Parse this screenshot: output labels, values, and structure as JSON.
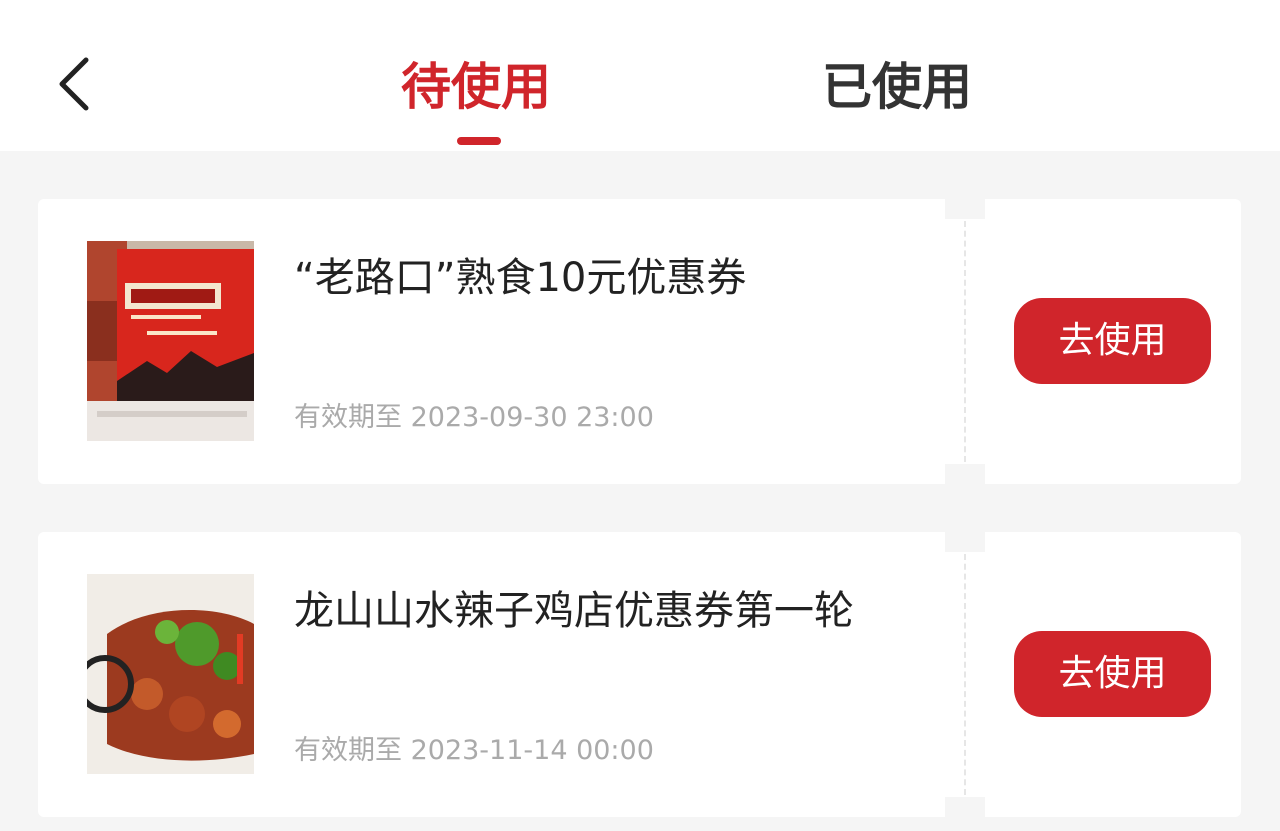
{
  "header": {
    "tabs": [
      {
        "label": "待使用",
        "active": true
      },
      {
        "label": "已使用",
        "active": false
      }
    ],
    "back_icon": "chevron-left-icon",
    "accent_color": "#d0252b"
  },
  "coupons": [
    {
      "title": "“老路口”熟食10元优惠券",
      "validity": "有效期至 2023-09-30 23:00",
      "button_label": "去使用",
      "image": "braised-food-box-photo"
    },
    {
      "title": "龙山山水辣子鸡店优惠券第一轮",
      "validity": "有效期至 2023-11-14 00:00",
      "button_label": "去使用",
      "image": "spicy-chicken-dish-photo"
    }
  ]
}
